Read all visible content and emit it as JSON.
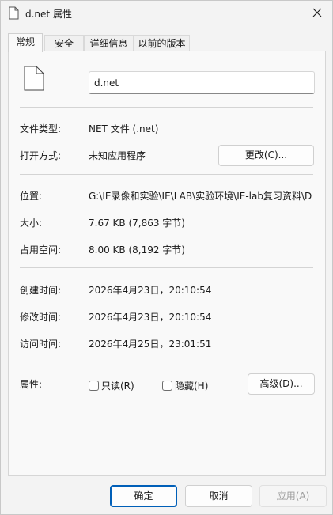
{
  "window": {
    "title": "d.net 属性"
  },
  "tabs": [
    {
      "label": "常规",
      "active": true
    },
    {
      "label": "安全",
      "active": false
    },
    {
      "label": "详细信息",
      "active": false
    },
    {
      "label": "以前的版本",
      "active": false
    }
  ],
  "general": {
    "filename": "d.net",
    "file_type_label": "文件类型:",
    "file_type_value": "NET 文件 (.net)",
    "opens_with_label": "打开方式:",
    "opens_with_value": "未知应用程序",
    "change_button": "更改(C)...",
    "location_label": "位置:",
    "location_value": "G:\\IE录像和实验\\IE\\LAB\\实验环境\\IE-lab复习资料\\D",
    "size_label": "大小:",
    "size_value": "7.67 KB (7,863 字节)",
    "size_on_disk_label": "占用空间:",
    "size_on_disk_value": "8.00 KB (8,192 字节)",
    "created_label": "创建时间:",
    "created_value": "2026年4月23日，20:10:54",
    "modified_label": "修改时间:",
    "modified_value": "2026年4月23日，20:10:54",
    "accessed_label": "访问时间:",
    "accessed_value": "2026年4月25日，23:01:51",
    "attributes_label": "属性:",
    "readonly_label": "只读(R)",
    "readonly_checked": false,
    "hidden_label": "隐藏(H)",
    "hidden_checked": false,
    "advanced_button": "高级(D)..."
  },
  "footer": {
    "ok": "确定",
    "cancel": "取消",
    "apply": "应用(A)"
  },
  "colors": {
    "accent": "#005fb8"
  }
}
